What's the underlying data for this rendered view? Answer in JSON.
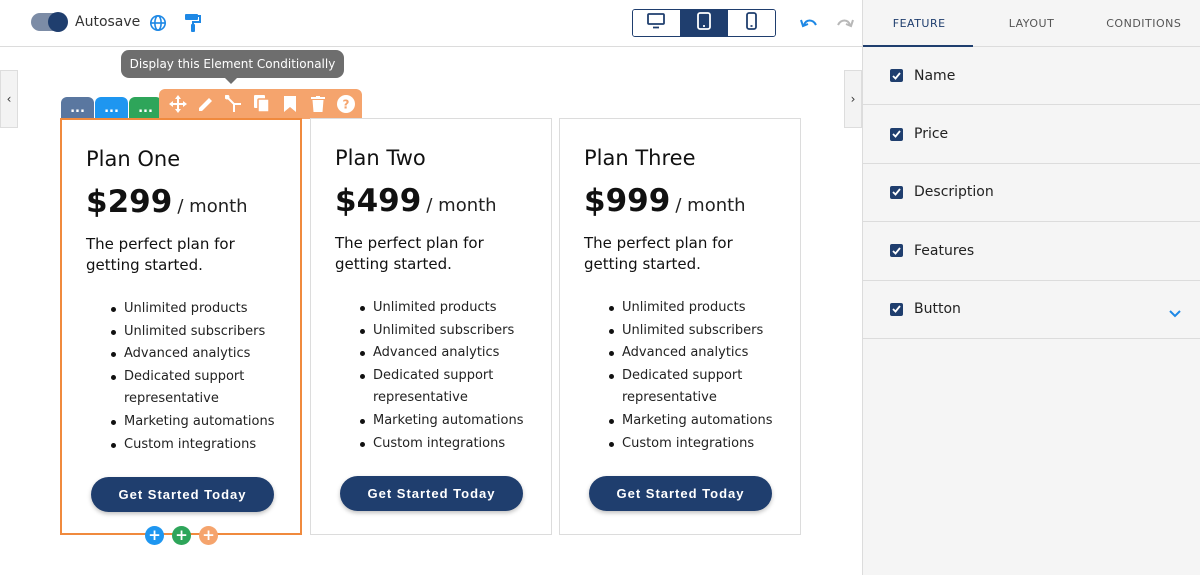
{
  "toolbar": {
    "autosave_label": "Autosave",
    "autosave_on": true,
    "icons": [
      "globe-icon",
      "paint-roller-icon"
    ],
    "devices": [
      {
        "icon": "desktop-icon",
        "active": false
      },
      {
        "icon": "tablet-icon",
        "active": true
      },
      {
        "icon": "mobile-icon",
        "active": false
      }
    ],
    "history": [
      "undo-icon",
      "redo-icon"
    ]
  },
  "tooltip": "Display this Element Conditionally",
  "element_tabs": [
    {
      "label": "...",
      "color": "#5a77a0"
    },
    {
      "label": "...",
      "color": "#1e96f0"
    },
    {
      "label": "...",
      "color": "#2ea55a"
    }
  ],
  "action_icons": [
    "move-icon",
    "edit-icon",
    "condition-icon",
    "duplicate-icon",
    "bookmark-icon",
    "delete-icon",
    "help-icon"
  ],
  "plans": [
    {
      "name": "Plan One",
      "price": "$299",
      "period": "/ month",
      "description": "The perfect plan for getting started.",
      "features": [
        "Unlimited products",
        "Unlimited subscribers",
        "Advanced analytics",
        "Dedicated support representative",
        "Marketing automations",
        "Custom integrations"
      ],
      "button": "Get Started Today",
      "selected": true
    },
    {
      "name": "Plan Two",
      "price": "$499",
      "period": "/ month",
      "description": "The perfect plan for getting started.",
      "features": [
        "Unlimited products",
        "Unlimited subscribers",
        "Advanced analytics",
        "Dedicated support representative",
        "Marketing automations",
        "Custom integrations"
      ],
      "button": "Get Started Today",
      "selected": false
    },
    {
      "name": "Plan Three",
      "price": "$999",
      "period": "/ month",
      "description": "The perfect plan for getting started.",
      "features": [
        "Unlimited products",
        "Unlimited subscribers",
        "Advanced analytics",
        "Dedicated support representative",
        "Marketing automations",
        "Custom integrations"
      ],
      "button": "Get Started Today",
      "selected": false
    }
  ],
  "add_buttons": [
    {
      "label": "+",
      "color": "#1e96f0"
    },
    {
      "label": "+",
      "color": "#2ea55a"
    },
    {
      "label": "+",
      "color": "#f5a46d"
    }
  ],
  "panel": {
    "tabs": [
      {
        "label": "FEATURE",
        "active": true
      },
      {
        "label": "LAYOUT",
        "active": false
      },
      {
        "label": "CONDITIONS",
        "active": false
      }
    ],
    "rows": [
      {
        "label": "Name",
        "checked": true
      },
      {
        "label": "Price",
        "checked": true
      },
      {
        "label": "Description",
        "checked": true
      },
      {
        "label": "Features",
        "checked": true
      },
      {
        "label": "Button",
        "checked": true
      }
    ]
  },
  "colors": {
    "primary": "#1f3e6e",
    "accent_orange": "#f5a46d",
    "selected_border": "#f08a3e",
    "link_blue": "#1e88e5"
  }
}
